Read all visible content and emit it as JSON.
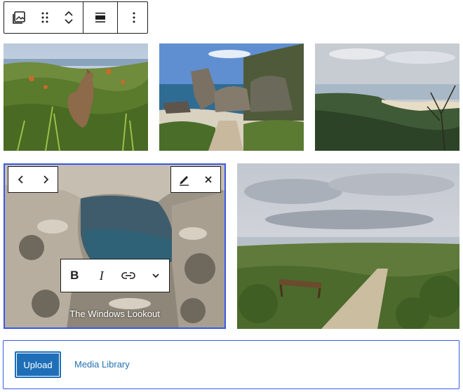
{
  "toolbar": {
    "icons": [
      "gallery-icon",
      "drag-handle-icon",
      "move-up-icon",
      "move-down-icon",
      "align-icon",
      "more-options-icon"
    ]
  },
  "gallery": {
    "images": [
      {
        "name": "kangaroo-image"
      },
      {
        "name": "rock-beach-image"
      },
      {
        "name": "coast-bay-image"
      },
      {
        "name": "windows-lookout-image",
        "caption": "The Windows Lookout",
        "selected": true
      },
      {
        "name": "path-bench-image"
      }
    ]
  },
  "image_nav": {
    "icons": [
      "chevron-left-icon",
      "chevron-right-icon"
    ]
  },
  "image_actions": {
    "icons": [
      "edit-pencil-icon",
      "close-icon"
    ]
  },
  "format_toolbar": {
    "bold": "B",
    "italic": "I",
    "icons": [
      "link-icon",
      "chevron-down-icon"
    ]
  },
  "uploader": {
    "upload_label": "Upload",
    "media_library_label": "Media Library"
  },
  "colors": {
    "accent": "#3858e9",
    "button": "#1e6fb8",
    "link": "#2271b1"
  }
}
